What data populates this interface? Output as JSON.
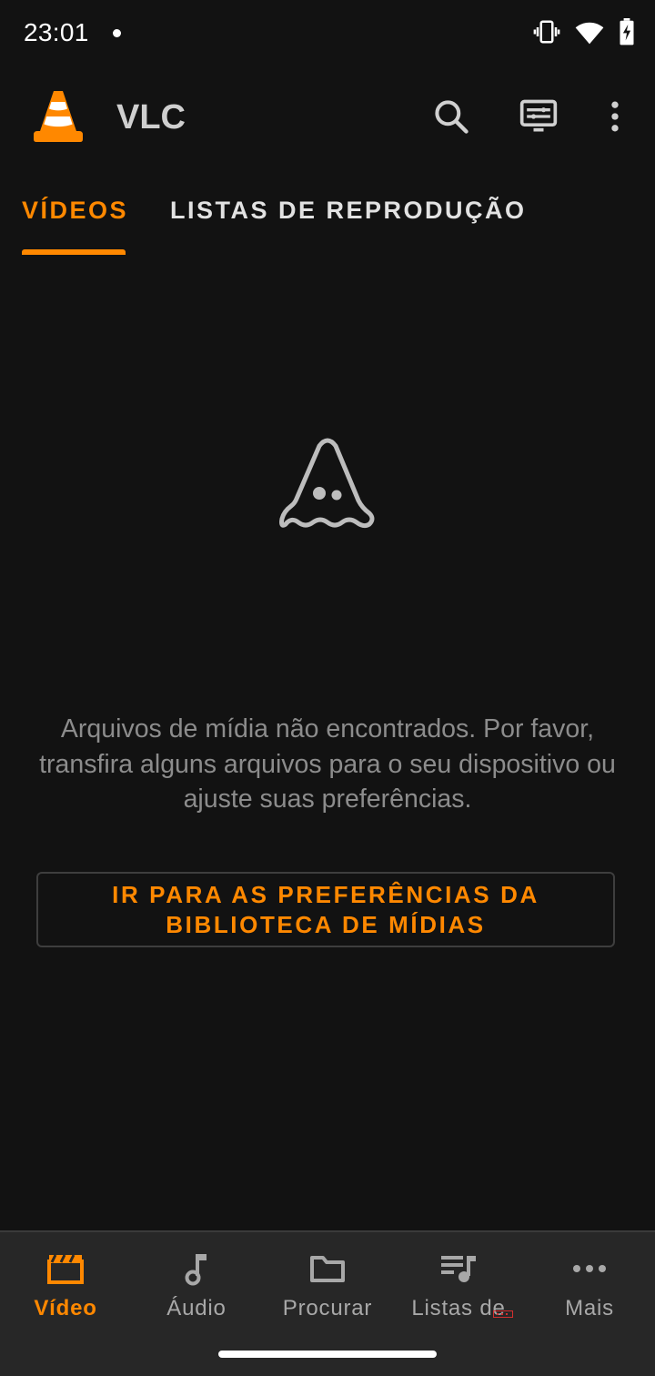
{
  "status_bar": {
    "time": "23:01",
    "icons": [
      "notification-dot",
      "vibrate-icon",
      "wifi-icon",
      "battery-charging-icon"
    ]
  },
  "app_bar": {
    "title": "VLC",
    "logo": "vlc-cone-logo",
    "actions": [
      "search-icon",
      "renderer-cast-icon",
      "more-vert-icon"
    ]
  },
  "tabs": [
    {
      "label": "VÍDEOS",
      "active": true
    },
    {
      "label": "LISTAS DE REPRODUÇÃO",
      "active": false
    }
  ],
  "empty_state": {
    "icon": "ghost-cone-icon",
    "message": "Arquivos de mídia não encontrados. Por favor, transfira alguns arquivos para o seu dispositivo ou ajuste suas preferências.",
    "button_label": "IR PARA AS PREFERÊNCIAS DA BIBLIOTECA DE MÍDIAS"
  },
  "bottom_nav": {
    "items": [
      {
        "label": "Vídeo",
        "icon": "clapperboard-icon",
        "active": true
      },
      {
        "label": "Áudio",
        "icon": "music-note-icon",
        "active": false
      },
      {
        "label": "Procurar",
        "icon": "folder-icon",
        "active": false
      },
      {
        "label": "Listas de",
        "icon": "playlist-icon",
        "active": false
      },
      {
        "label": "Mais",
        "icon": "more-horiz-icon",
        "active": false
      }
    ]
  },
  "colors": {
    "accent": "#ff8800",
    "background": "#121212",
    "nav_background": "#272727",
    "muted_text": "#8c8c8c"
  }
}
